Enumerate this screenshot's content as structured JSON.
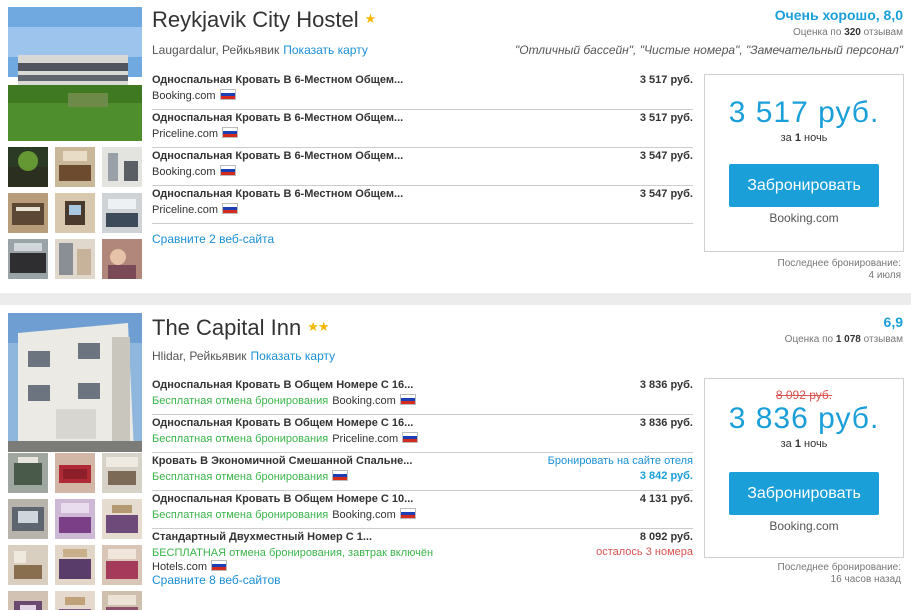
{
  "hotels": [
    {
      "name": "Reykjavik City Hostel",
      "stars": "★",
      "location": "Laugardalur, Рейкьявик",
      "map_link": "Показать карту",
      "rating_label": "Очень хорошо, 8,0",
      "reviews_prefix": "Оценка по",
      "reviews_count": "320",
      "reviews_suffix": "отзывам",
      "quote": "\"Отличный бассейн\", \"Чистые номера\", \"Замечательный персонал\"",
      "offers": [
        {
          "room": "Односпальная Кровать В 6-Местном Общем...",
          "site": "Booking.com",
          "price": "3 517 руб."
        },
        {
          "room": "Односпальная Кровать В 6-Местном Общем...",
          "site": "Priceline.com",
          "price": "3 517 руб."
        },
        {
          "room": "Односпальная Кровать В 6-Местном Общем...",
          "site": "Booking.com",
          "price": "3 547 руб."
        },
        {
          "room": "Односпальная Кровать В 6-Местном Общем...",
          "site": "Priceline.com",
          "price": "3 547 руб."
        }
      ],
      "compare": "Сравните 2 веб-сайта",
      "best_price": "3 517 руб.",
      "per_night_prefix": "за",
      "per_night_count": "1",
      "per_night_suffix": "ночь",
      "book_button": "Забронировать",
      "book_provider": "Booking.com",
      "last_booking_label": "Последнее бронирование:",
      "last_booking_value": "4 июля"
    },
    {
      "name": "The Capital Inn",
      "stars": "★★",
      "location": "Hlidar, Рейкьявик",
      "map_link": "Показать карту",
      "rating_label": "6,9",
      "reviews_prefix": "Оценка по",
      "reviews_count": "1 078",
      "reviews_suffix": "отзывам",
      "offers": [
        {
          "room": "Односпальная Кровать В Общем Номере С 16...",
          "free": "Бесплатная отмена бронирования",
          "site": "Booking.com",
          "price": "3 836 руб."
        },
        {
          "room": "Односпальная Кровать В Общем Номере С 16...",
          "free": "Бесплатная отмена бронирования",
          "site": "Priceline.com",
          "price": "3 836 руб."
        },
        {
          "room": "Кровать В Экономичной Смешанной Спальне...",
          "free": "Бесплатная отмена бронирования",
          "site": "",
          "book_on_site": "Бронировать на сайте отеля",
          "price": "3 842 руб."
        },
        {
          "room": "Односпальная Кровать В Общем Номере С 10...",
          "free": "Бесплатная отмена бронирования",
          "site": "Booking.com",
          "price": "4 131 руб."
        },
        {
          "room": "Стандартный Двухместный Номер С 1...",
          "free": "БЕСПЛАТНАЯ отмена бронирования, завтрак включён",
          "site": "Hotels.com",
          "price": "8 092 руб.",
          "warning": "осталось 3 номера"
        }
      ],
      "compare": "Сравните 8 веб-сайтов",
      "old_price": "8 092 руб.",
      "best_price": "3 836 руб.",
      "per_night_prefix": "за",
      "per_night_count": "1",
      "per_night_suffix": "ночь",
      "book_button": "Забронировать",
      "book_provider": "Booking.com",
      "last_booking_label": "Последнее бронирование:",
      "last_booking_value": "16 часов назад"
    }
  ],
  "colors": {
    "accent": "#1a9fd9",
    "link": "#1a8fd6",
    "free_cancel": "#3ab54a",
    "old_price": "#d9534f",
    "star": "#f5b800"
  }
}
